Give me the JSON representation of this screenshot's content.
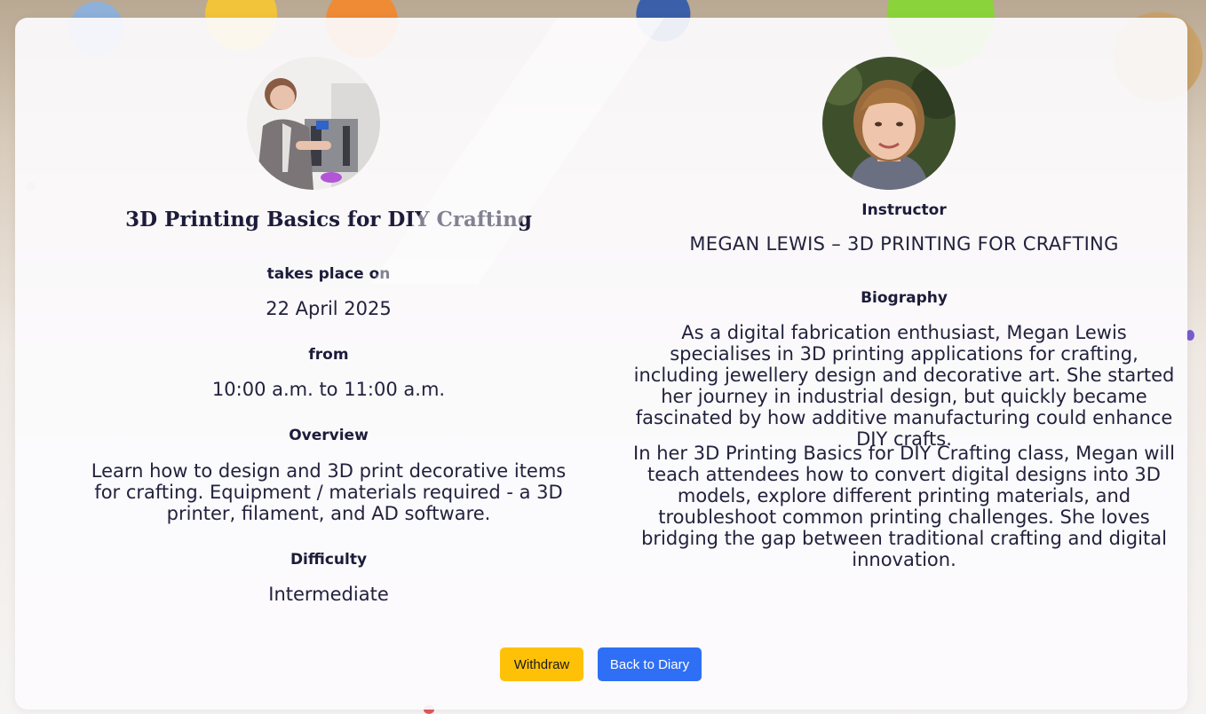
{
  "class": {
    "title": "3D Printing Basics for DIY Crafting",
    "date_label": "takes place on",
    "date": "22 April 2025",
    "time_label": "from",
    "time": "10:00 a.m. to 11:00 a.m.",
    "overview_label": "Overview",
    "overview": "Learn how to design and 3D print decorative items for crafting. Equipment / materials required - a 3D printer, filament, and AD software.",
    "difficulty_label": "Difficulty",
    "difficulty": "Intermediate"
  },
  "instructor": {
    "label": "Instructor",
    "name": "MEGAN LEWIS – 3D PRINTING FOR CRAFTING",
    "biography_label": "Biography",
    "bio_paragraph_1": "As a digital fabrication enthusiast, Megan Lewis specialises in 3D printing applications for crafting, including jewellery design and decorative art. She started her journey in industrial design, but quickly became fascinated by how additive manufacturing could enhance DIY crafts.",
    "bio_paragraph_2": "In her 3D Printing Basics for DIY Crafting class, Megan will teach attendees how to convert digital designs into 3D models, explore different printing materials, and troubleshoot common printing challenges. She loves bridging the gap between traditional crafting and digital innovation."
  },
  "actions": {
    "withdraw_label": "Withdraw",
    "back_label": "Back to Diary"
  },
  "colors": {
    "withdraw_bg": "#ffc107",
    "back_bg": "#2f6ff5",
    "text": "#1c1c3a"
  }
}
